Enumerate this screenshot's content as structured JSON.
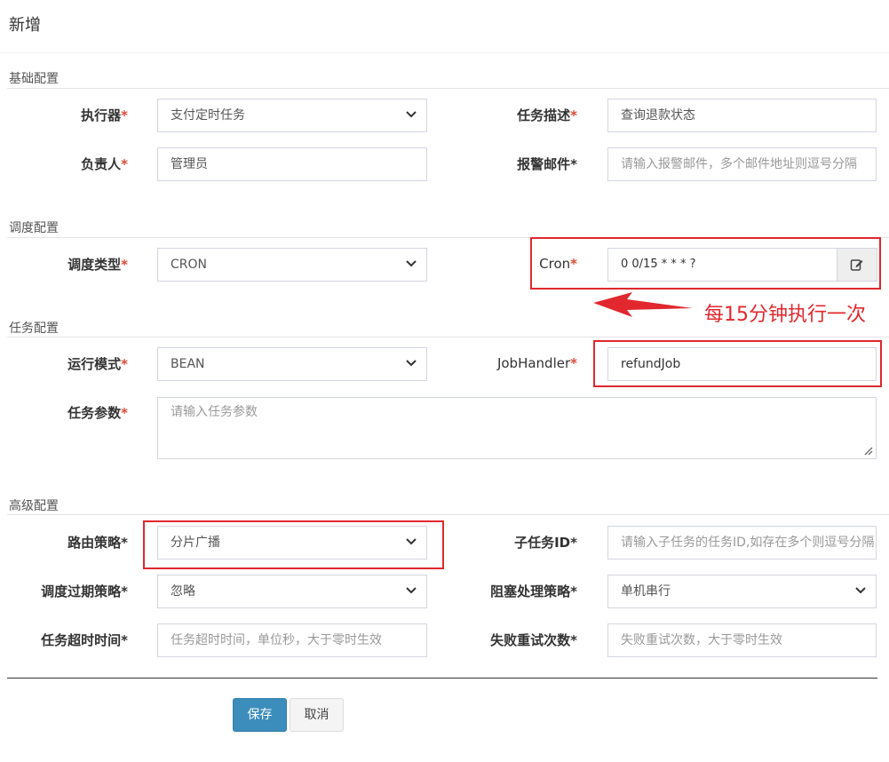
{
  "modal": {
    "title": "新增"
  },
  "sections": {
    "basic": "基础配置",
    "schedule": "调度配置",
    "task": "任务配置",
    "advanced": "高级配置"
  },
  "fields": {
    "executor": {
      "label": "执行器",
      "value": "支付定时任务"
    },
    "job_desc": {
      "label": "任务描述",
      "value": "查询退款状态"
    },
    "author": {
      "label": "负责人",
      "value": "管理员"
    },
    "alarm_email": {
      "label": "报警邮件",
      "placeholder": "请输入报警邮件，多个邮件地址则逗号分隔"
    },
    "schedule_type": {
      "label": "调度类型",
      "value": "CRON"
    },
    "cron": {
      "label": "Cron",
      "value": "0 0/15 * * * ?"
    },
    "glue_type": {
      "label": "运行模式",
      "value": "BEAN"
    },
    "job_handler": {
      "label": "JobHandler",
      "value": "refundJob"
    },
    "job_param": {
      "label": "任务参数",
      "placeholder": "请输入任务参数"
    },
    "route_strategy": {
      "label": "路由策略",
      "value": "分片广播"
    },
    "child_job_id": {
      "label": "子任务ID",
      "placeholder": "请输入子任务的任务ID,如存在多个则逗号分隔"
    },
    "misfire_strategy": {
      "label": "调度过期策略",
      "value": "忽略"
    },
    "block_strategy": {
      "label": "阻塞处理策略",
      "value": "单机串行"
    },
    "timeout": {
      "label": "任务超时时间",
      "placeholder": "任务超时时间，单位秒，大于零时生效"
    },
    "fail_retry": {
      "label": "失败重试次数",
      "placeholder": "失败重试次数，大于零时生效"
    }
  },
  "required_mark": "*",
  "buttons": {
    "save": "保存",
    "cancel": "取消"
  },
  "annotation": {
    "text": "每15分钟执行一次",
    "color": "#e0282e"
  },
  "icons": {
    "cron_edit": "edit-icon",
    "dropdown": "chevron-down-icon"
  },
  "colors": {
    "primary": "#3c8dbc",
    "required": "#dd4b39",
    "highlight": "#e0282e"
  }
}
